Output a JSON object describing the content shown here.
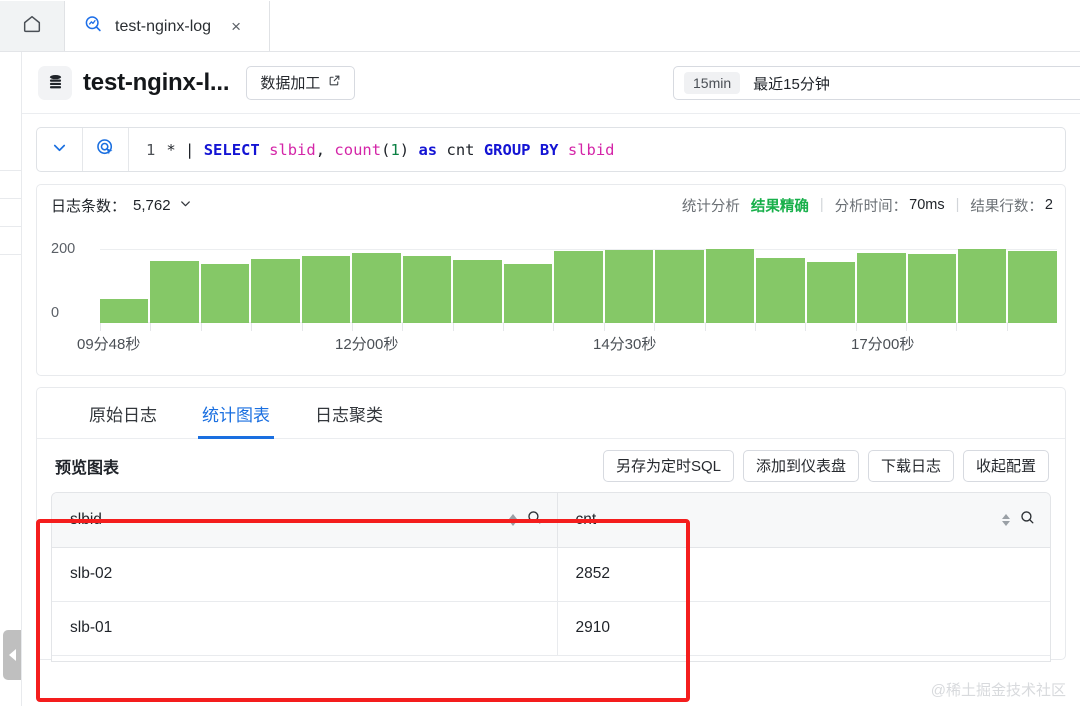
{
  "browser": {
    "home_icon": "home-icon",
    "tab": {
      "favicon": "search-analytics-icon",
      "title": "test-nginx-log",
      "close": "×"
    }
  },
  "header": {
    "db_icon": "database-icon",
    "title": "test-nginx-l...",
    "data_process_button": "数据加工",
    "external_link_icon": "external-link-icon",
    "time_picker": {
      "badge": "15min",
      "label": "最近15分钟"
    }
  },
  "query": {
    "chevron_icon": "chevron-down-icon",
    "target_icon": "query-target-icon",
    "line_number": "1",
    "tokens": [
      {
        "t": "*",
        "c": "plain"
      },
      {
        "t": "|",
        "c": "op"
      },
      {
        "t": "SELECT",
        "c": "kw"
      },
      {
        "t": "slbid",
        "c": "fld"
      },
      {
        "t": ",",
        "c": "op"
      },
      {
        "t": "count",
        "c": "fld"
      },
      {
        "t": "(",
        "c": "op"
      },
      {
        "t": "1",
        "c": "num"
      },
      {
        "t": ")",
        "c": "op"
      },
      {
        "t": "as",
        "c": "kw"
      },
      {
        "t": "cnt",
        "c": "plain"
      },
      {
        "t": "GROUP",
        "c": "kw"
      },
      {
        "t": "BY",
        "c": "kw"
      },
      {
        "t": "slbid",
        "c": "fld"
      }
    ],
    "raw": "1  *  |  SELECT slbid, count(1) as cnt GROUP BY slbid"
  },
  "stats": {
    "log_count_label": "日志条数：",
    "log_count_value": "5,762",
    "log_count_chevron": "chevron-down-icon",
    "analysis_mode": "统计分析",
    "accuracy": "结果精确",
    "analysis_time_label": "分析时间：",
    "analysis_time_value": "70ms",
    "row_count_label": "结果行数：",
    "row_count_value": "2"
  },
  "chart_data": {
    "type": "bar",
    "title": "",
    "xlabel": "",
    "ylabel": "",
    "ylim": [
      0,
      200
    ],
    "yticks": [
      "0",
      "200"
    ],
    "grid": true,
    "legend": "none",
    "xtick_labels": [
      "09分48秒",
      "12分00秒",
      "14分30秒",
      "17分00秒"
    ],
    "categories": [
      "b1",
      "b2",
      "b3",
      "b4",
      "b5",
      "b6",
      "b7",
      "b8",
      "b9",
      "b10",
      "b11",
      "b12",
      "b13",
      "b14",
      "b15",
      "b16",
      "b17",
      "b18",
      "b19"
    ],
    "values": [
      67,
      171,
      163,
      175,
      183,
      192,
      183,
      172,
      161,
      197,
      200,
      200,
      203,
      178,
      166,
      192,
      188,
      202,
      197
    ],
    "bar_color": "#7bc35a"
  },
  "tabs": {
    "items": [
      {
        "label": "原始日志",
        "active": false
      },
      {
        "label": "统计图表",
        "active": true
      },
      {
        "label": "日志聚类",
        "active": false
      }
    ]
  },
  "preview": {
    "title": "预览图表",
    "actions": [
      "另存为定时SQL",
      "添加到仪表盘",
      "下载日志",
      "收起配置"
    ]
  },
  "result_table": {
    "columns": [
      {
        "name": "slbid",
        "sort_icon": "sort-icon",
        "search_icon": "search-icon"
      },
      {
        "name": "cnt",
        "sort_icon": "sort-icon",
        "search_icon": "search-icon"
      }
    ],
    "rows": [
      {
        "slbid": "slb-02",
        "cnt": "2852"
      },
      {
        "slbid": "slb-01",
        "cnt": "2910"
      }
    ]
  },
  "annotation": {
    "highlight_color": "#f41d1d"
  },
  "watermark": "@稀土掘金技术社区",
  "sidebar": {
    "collapse_handle_icon": "chevron-left-icon"
  }
}
